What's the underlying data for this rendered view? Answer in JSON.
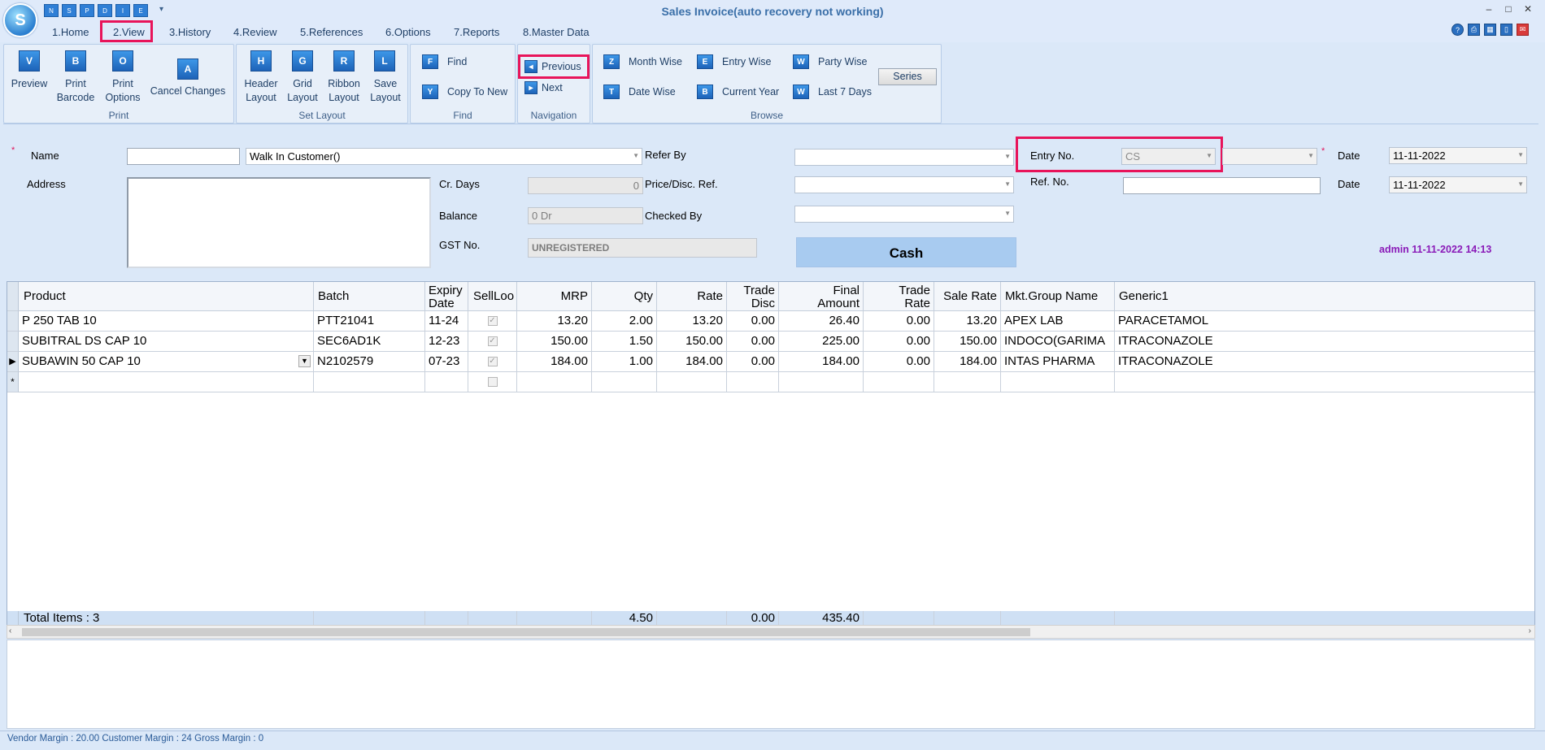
{
  "window": {
    "title": "Sales Invoice(auto recovery not working)",
    "logo_text": "S",
    "quick_access": [
      "N",
      "S",
      "P",
      "D",
      "I",
      "E"
    ],
    "controls": [
      "–",
      "□",
      "✕"
    ]
  },
  "menu": {
    "tabs": [
      "1.Home",
      "2.View",
      "3.History",
      "4.Review",
      "5.References",
      "6.Options",
      "7.Reports",
      "8.Master Data"
    ],
    "active": "2.View",
    "right_icons": [
      "?",
      "⎙",
      "▦",
      "▯",
      "✉"
    ]
  },
  "ribbon": {
    "print": {
      "label": "Print",
      "buttons": [
        {
          "icon": "V",
          "label": "Preview"
        },
        {
          "icon": "B",
          "label": "Print\nBarcode"
        },
        {
          "icon": "O",
          "label": "Print\nOptions"
        },
        {
          "icon": "A",
          "label": "Cancel Changes"
        }
      ]
    },
    "set_layout": {
      "label": "Set Layout",
      "buttons": [
        {
          "icon": "H",
          "label": "Header\nLayout"
        },
        {
          "icon": "G",
          "label": "Grid\nLayout"
        },
        {
          "icon": "R",
          "label": "Ribbon\nLayout"
        },
        {
          "icon": "L",
          "label": "Save\nLayout"
        }
      ]
    },
    "find": {
      "label": "Find",
      "buttons": [
        {
          "icon": "F",
          "label": "Find"
        },
        {
          "icon": "Y",
          "label": "Copy To New"
        }
      ]
    },
    "navigation": {
      "label": "Navigation",
      "buttons": [
        {
          "icon": "◂",
          "label": "Previous"
        },
        {
          "icon": "▸",
          "label": "Next"
        }
      ]
    },
    "browse": {
      "label": "Browse",
      "buttons": [
        {
          "icon": "Z",
          "label": "Month Wise"
        },
        {
          "icon": "T",
          "label": "Date Wise"
        },
        {
          "icon": "E",
          "label": "Entry Wise"
        },
        {
          "icon": "B",
          "label": "Current Year"
        },
        {
          "icon": "W",
          "label": "Party Wise"
        },
        {
          "icon": "W",
          "label": "Last 7 Days"
        }
      ],
      "series_label": "Series"
    }
  },
  "form": {
    "required_mark": "*",
    "name_label": "Name",
    "name_code": "",
    "customer_value": "Walk In Customer()",
    "address_label": "Address",
    "address_value": "",
    "cr_days_label": "Cr. Days",
    "cr_days_value": "0",
    "balance_label": "Balance",
    "balance_value": "0 Dr",
    "gst_label": "GST No.",
    "gst_value": "UNREGISTERED",
    "refer_by_label": "Refer By",
    "price_disc_label": "Price/Disc. Ref.",
    "checked_by_label": "Checked By",
    "entry_no_label": "Entry No.",
    "entry_no_value": "CS",
    "ref_no_label": "Ref. No.",
    "ref_no_value": "",
    "date_label": "Date",
    "date_value": "11-11-2022",
    "date2_label": "Date",
    "date2_value": "11-11-2022",
    "cash_label": "Cash",
    "user_stamp": "admin 11-11-2022 14:13"
  },
  "grid": {
    "columns": [
      "Product",
      "Batch",
      "Expiry\nDate",
      "SellLoo",
      "MRP",
      "Qty",
      "Rate",
      "Trade\nDisc",
      "Final\nAmount",
      "Trade\nRate",
      "Sale Rate",
      "Mkt.Group Name",
      "Generic1"
    ],
    "rows": [
      [
        "P 250 TAB 10",
        "PTT21041",
        "11-24",
        "✓",
        "13.20",
        "2.00",
        "13.20",
        "0.00",
        "26.40",
        "0.00",
        "13.20",
        "APEX LAB",
        "PARACETAMOL"
      ],
      [
        "SUBITRAL DS CAP 10",
        "SEC6AD1K",
        "12-23",
        "✓",
        "150.00",
        "1.50",
        "150.00",
        "0.00",
        "225.00",
        "0.00",
        "150.00",
        "INDOCO(GARIMA",
        "ITRACONAZOLE"
      ],
      [
        "SUBAWIN 50 CAP 10",
        "N2102579",
        "07-23",
        "✓",
        "184.00",
        "1.00",
        "184.00",
        "0.00",
        "184.00",
        "0.00",
        "184.00",
        "INTAS PHARMA",
        "ITRACONAZOLE"
      ]
    ],
    "new_row_marker": "*",
    "current_row_marker": "▶",
    "totals": {
      "label": "Total Items : 3",
      "qty": "4.50",
      "trade_disc": "0.00",
      "final_amount": "435.40"
    }
  },
  "status": {
    "text": "Vendor Margin : 20.00 Customer Margin : 24 Gross Margin : 0"
  }
}
